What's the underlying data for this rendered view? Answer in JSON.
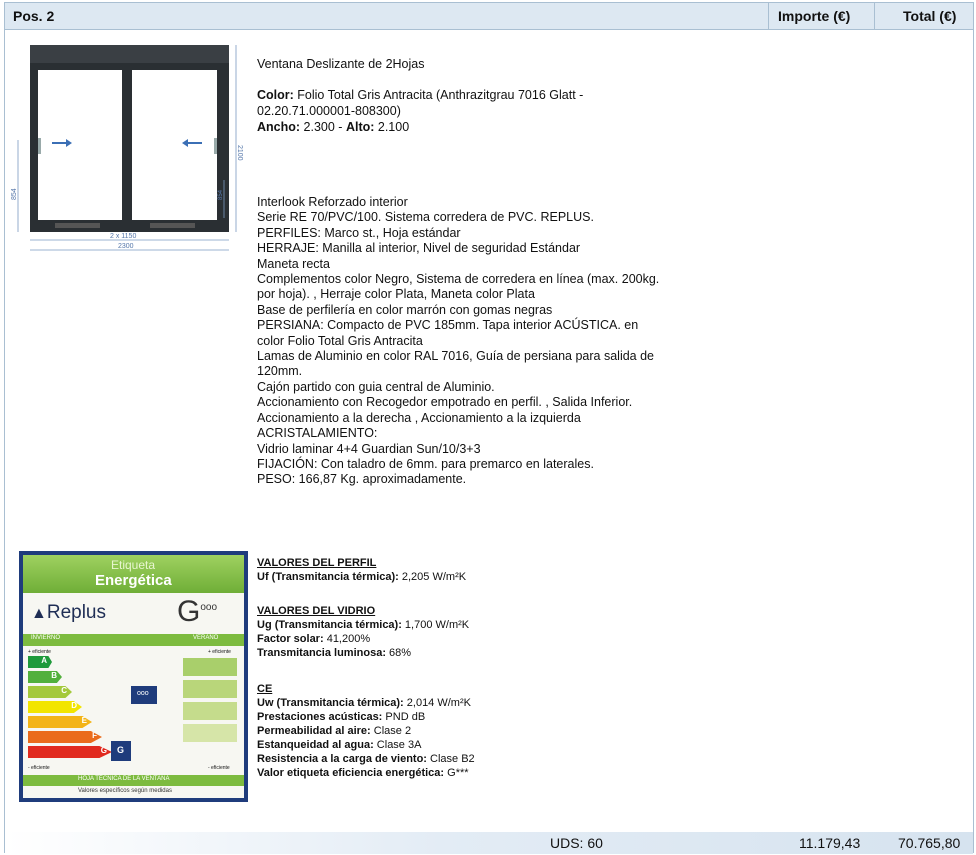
{
  "header": {
    "pos": "Pos. 2",
    "importe": "Importe (€)",
    "total": "Total (€)"
  },
  "drawing": {
    "width_label": "2 x 1150",
    "total_width": "2300",
    "height_right": "2100",
    "left_dim": "854",
    "mid_dim": "854"
  },
  "product": {
    "title": "Ventana Deslizante de 2Hojas",
    "color_label": "Color:",
    "color_value": " Folio Total Gris Antracita (Anthrazitgrau 7016 Glatt -",
    "color_value2": "02.20.71.000001-808300)",
    "ancho_label": "Ancho:",
    "ancho_value": " 2.300 - ",
    "alto_label": "Alto:",
    "alto_value": " 2.100"
  },
  "description": [
    "Interlook Reforzado interior",
    "Serie RE 70/PVC/100. Sistema corredera de PVC. REPLUS.",
    "PERFILES: Marco st., Hoja estándar",
    "HERRAJE: Manilla al interior, Nivel de seguridad Estándar",
    "Maneta recta",
    "Complementos color Negro, Sistema de corredera en línea (max. 200kg.",
    "por hoja). , Herraje color Plata, Maneta color Plata",
    "Base de perfilería en color marrón con gomas negras",
    "PERSIANA: Compacto de PVC 185mm. Tapa interior ACÚSTICA. en",
    "color Folio Total Gris Antracita",
    "Lamas de Aluminio en color RAL 7016, Guía de persiana para salida de",
    "120mm.",
    "Cajón partido con guia central de Aluminio.",
    "Accionamiento con Recogedor empotrado en perfil. , Salida Inferior.",
    "Accionamiento a la derecha , Accionamiento a la izquierda",
    "ACRISTALAMIENTO:",
    "Vidrio laminar 4+4 Guardian Sun/10/3+3",
    "FIJACIÓN: Con taladro de 6mm. para premarco en laterales.",
    "PESO: 166,87 Kg. aproximadamente."
  ],
  "label": {
    "header1": "Etiqueta",
    "header2": "Energética",
    "brand": "Replus",
    "class_big": "G",
    "class_sup": "ooo",
    "invierno": "INVIERNO",
    "verano": "VERANO",
    "mas_eficiente_l": "+ eficiente",
    "mas_eficiente_r": "+ eficiente",
    "menos_eficiente_l": "- eficiente",
    "menos_eficiente_r": "- eficiente",
    "bars": [
      "A",
      "B",
      "C",
      "D",
      "E",
      "F",
      "G"
    ],
    "left_badge": "ooo",
    "g_badge": "G",
    "footer1": "HOJA TÉCNICA DE LA VENTANA",
    "footer2": "Valores específicos según medidas",
    "colors": {
      "green_top": "#7dbb3f",
      "a": "#1f9a3b",
      "b": "#52b03c",
      "c": "#a4c93b",
      "d": "#f2e500",
      "e": "#f3b417",
      "f": "#ea6b1c",
      "g": "#e12a1f",
      "navy": "#1f3c7c"
    }
  },
  "perfil": {
    "title": "VALORES DEL PERFIL",
    "uf_label": "Uf (Transmitancia térmica):",
    "uf_value": " 2,205 W/m²K"
  },
  "vidrio": {
    "title": "VALORES DEL VIDRIO",
    "ug_label": "Ug (Transmitancia térmica):",
    "ug_value": " 1,700 W/m²K",
    "fs_label": "Factor solar:",
    "fs_value": " 41,200%",
    "tl_label": "Transmitancia luminosa:",
    "tl_value": " 68%"
  },
  "ce": {
    "title": "CE",
    "uw_label": "Uw (Transmitancia térmica):",
    "uw_value": " 2,014 W/m²K",
    "ac_label": "Prestaciones acústicas:",
    "ac_value": " PND dB",
    "pa_label": "Permeabilidad al aire:",
    "pa_value": " Clase 2",
    "ea_label": "Estanqueidad al agua:",
    "ea_value": " Clase 3A",
    "rv_label": "Resistencia a la carga de viento:",
    "rv_value": " Clase B2",
    "ve_label": "Valor etiqueta eficiencia energética:",
    "ve_value": " G***"
  },
  "footer": {
    "uds": "UDS: 60",
    "importe": "11.179,43",
    "total": "70.765,80"
  }
}
